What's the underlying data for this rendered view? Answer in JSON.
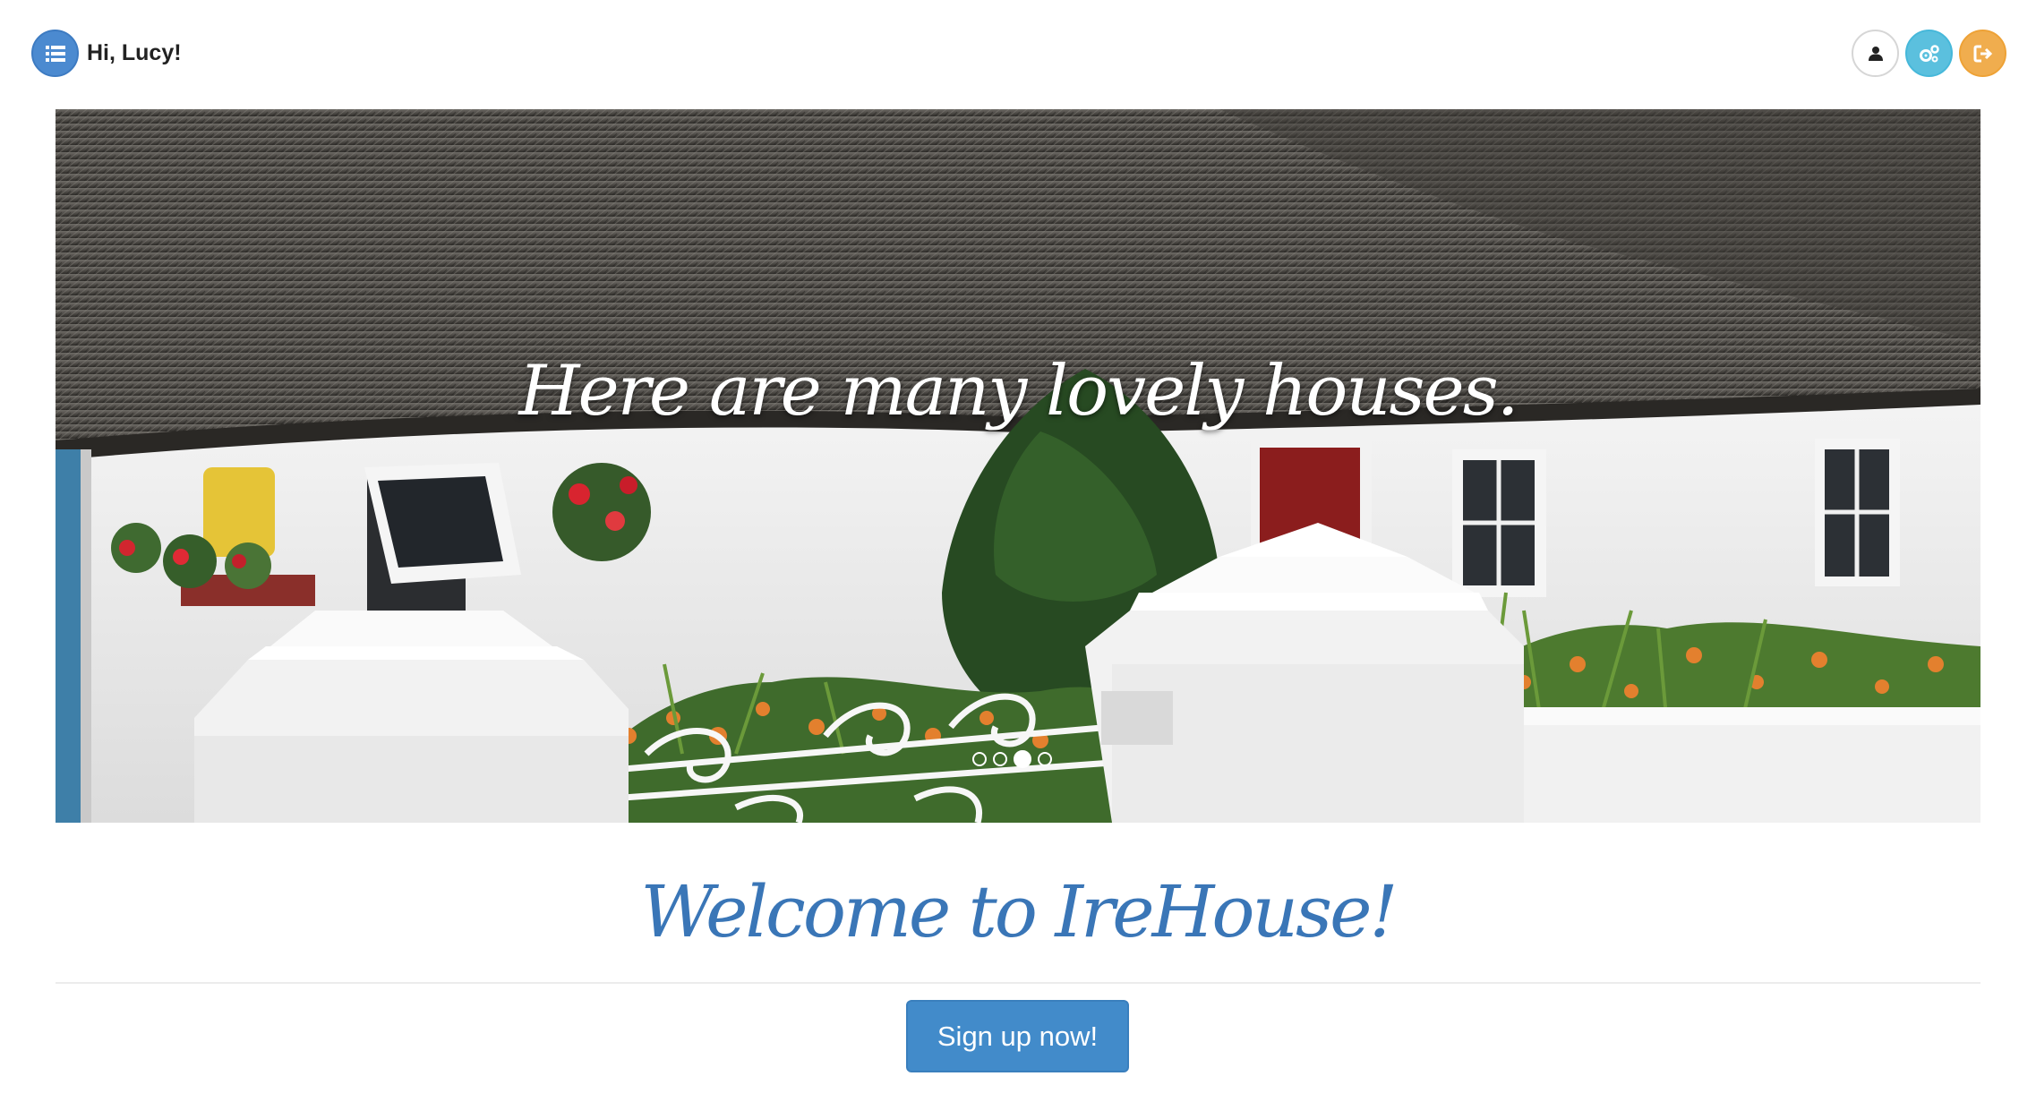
{
  "header": {
    "greeting": "Hi, Lucy!"
  },
  "icons": {
    "menu": "list-icon",
    "user": "user-icon",
    "settings": "cogs-icon",
    "logout": "sign-out-icon"
  },
  "colors": {
    "primary": "#428bca",
    "info": "#5bc0de",
    "warning": "#f0ad4e",
    "welcome_text": "#3a76b7"
  },
  "carousel": {
    "caption": "Here are many lovely houses.",
    "slide_count": 4,
    "active_slide": 3
  },
  "main": {
    "welcome": "Welcome to IreHouse!",
    "signup_label": "Sign up now!"
  }
}
